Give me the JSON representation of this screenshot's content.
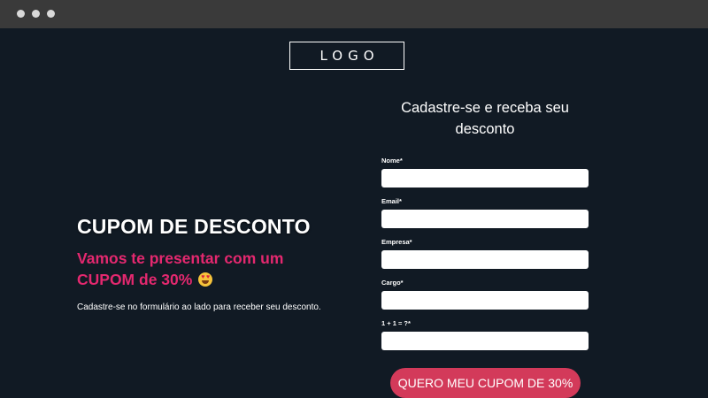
{
  "browser": {
    "dots": [
      "close",
      "minimize",
      "maximize"
    ]
  },
  "header": {
    "logo": "LOGO"
  },
  "hero": {
    "title": "CUPOM DE DESCONTO",
    "subtitle_line1": "Vamos te presentar com um",
    "subtitle_line2": "CUPOM de 30%",
    "emoji": "heart-eyes-emoji",
    "description": "Cadastre-se no formulário ao lado para receber seu desconto."
  },
  "form": {
    "title": "Cadastre-se e receba seu desconto",
    "fields": [
      {
        "label": "Nome*",
        "value": ""
      },
      {
        "label": "Email*",
        "value": ""
      },
      {
        "label": "Empresa*",
        "value": ""
      },
      {
        "label": "Cargo*",
        "value": ""
      },
      {
        "label": "1 + 1 = ?*",
        "value": ""
      }
    ],
    "submit_label": "QUERO MEU CUPOM DE 30%"
  },
  "colors": {
    "background": "#111a24",
    "accent_pink": "#e4286f",
    "button": "#d33a5a",
    "titlebar": "#3a3a3a"
  }
}
